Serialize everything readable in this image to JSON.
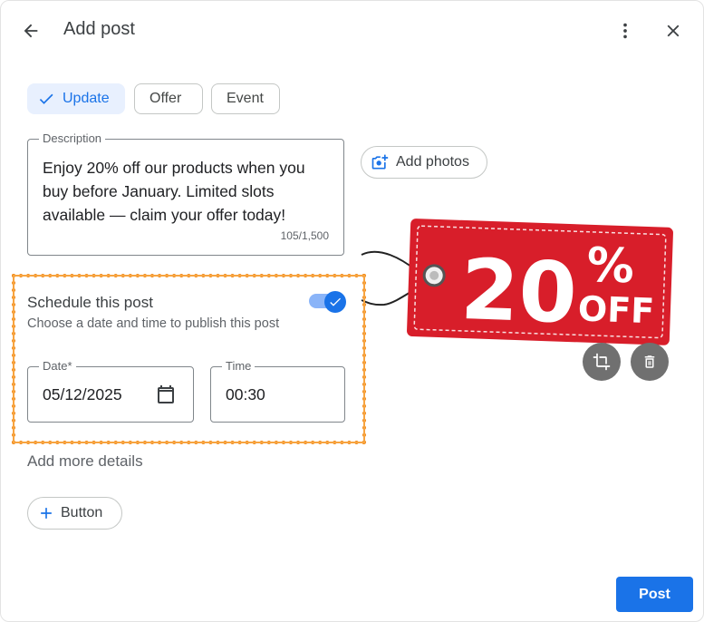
{
  "header": {
    "title": "Add post"
  },
  "post_types": [
    {
      "label": "Update",
      "selected": true
    },
    {
      "label": "Offer",
      "selected": false
    },
    {
      "label": "Event",
      "selected": false
    }
  ],
  "description": {
    "label": "Description",
    "value": "Enjoy 20% off our products when you buy before January. Limited slots available — claim your offer today!",
    "counter": "105/1,500"
  },
  "photos": {
    "add_label": "Add photos",
    "image": {
      "big_text": "20",
      "percent": "%",
      "off": "OFF"
    }
  },
  "schedule": {
    "title": "Schedule this post",
    "subtitle": "Choose a date and time to publish this post",
    "enabled": true,
    "date_label": "Date*",
    "date_value": "05/12/2025",
    "time_label": "Time",
    "time_value": "00:30"
  },
  "more_details": {
    "title": "Add more details",
    "button_label": "Button"
  },
  "footer": {
    "post_label": "Post"
  },
  "colors": {
    "accent": "#1a73e8",
    "highlight": "#f28c1c",
    "tag_red": "#d81e2a"
  }
}
